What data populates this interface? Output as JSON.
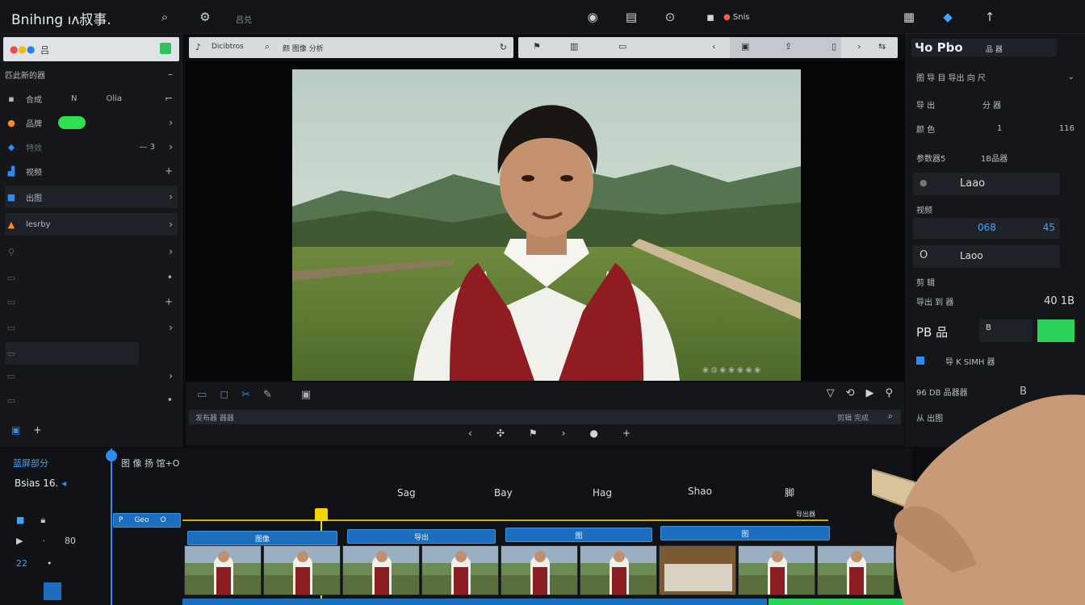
{
  "app": {
    "title": "Bnihıng ıʌ叔事."
  },
  "topbar": {
    "small_label": "吕兑",
    "center_label": "Snis"
  },
  "left_panel": {
    "search_placeholder": "吕",
    "section_title": "匹此新的器",
    "rows": [
      {
        "icon": "grid-icon",
        "label": "合成",
        "extra1": "N",
        "extra2": "Olia"
      },
      {
        "icon": "person-icon",
        "label": "品牌",
        "has_toggle": true
      },
      {
        "icon": "drop-icon",
        "label": "特效",
        "extra": "— 3"
      },
      {
        "icon": "chart-icon",
        "label": "视频"
      },
      {
        "icon": "square-icon",
        "label": "出图"
      },
      {
        "icon": "flame-icon",
        "label": "lesrby"
      }
    ]
  },
  "media_bar": {
    "label": "Dicibtros",
    "search": "颜 图像 分析"
  },
  "right_panel": {
    "title": "Чo Pbo",
    "subtitle_icons": "品 器",
    "dropdown": "图 导 目 导出 向 尺",
    "rows": [
      {
        "label": "导 出",
        "value": "分 器"
      },
      {
        "label": "颜 色",
        "value": "1",
        "value2": "116"
      },
      {
        "label": "参数器5",
        "value": "1B品器"
      },
      {
        "label": "Laao"
      },
      {
        "label": "视频"
      },
      {
        "value": "068",
        "value2": "45"
      },
      {
        "label": "Laoo"
      },
      {
        "label": "剪 辑"
      },
      {
        "label": "导出 到 器",
        "value": "40 1B"
      },
      {
        "label": "PB 品",
        "value": "B"
      },
      {
        "label": "导 K SIMH 器"
      },
      {
        "label": "96 DB 品器器",
        "value": "B"
      },
      {
        "label": "从 出图"
      }
    ]
  },
  "scrubber": {
    "label": "发布器 器器",
    "right_label": "剪辑 完成"
  },
  "timeline": {
    "track_title": "蓝屏部分",
    "time": "Bsias 16.",
    "playhead_label": "图 像 扬 馆+O",
    "column_labels": [
      "Sag",
      "Bay",
      "Hag",
      "Shao",
      "脚"
    ],
    "tracks": [
      {
        "labels": [
          "P",
          "Geo",
          "O"
        ]
      },
      {
        "labels": [
          "22",
          "80"
        ]
      }
    ],
    "clips": [
      "图像",
      "图",
      "导出",
      "导出",
      "图",
      "图",
      "图",
      "图"
    ],
    "footer_label": "导出器"
  }
}
